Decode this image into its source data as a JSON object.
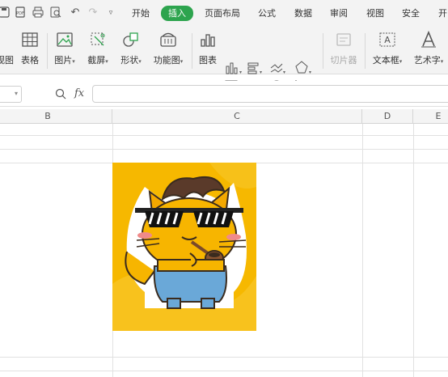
{
  "menubar": {
    "tabs": [
      "开始",
      "插入",
      "页面布局",
      "公式",
      "数据",
      "审阅",
      "视图",
      "安全",
      "开"
    ],
    "active_tab": "插入",
    "active_color": "#2da44e"
  },
  "ribbon": {
    "buttons": {
      "chart_view": "视图",
      "table": "表格",
      "picture": "图片",
      "screenshot": "截屏",
      "shape": "形状",
      "function_chart": "功能图",
      "chart": "图表",
      "slicer": "切片器",
      "textbox": "文本框",
      "wordart": "艺术字"
    }
  },
  "formula_bar": {
    "fx_label": "fx",
    "value": ""
  },
  "columns": {
    "B": "B",
    "C": "C",
    "D": "D",
    "E": "E"
  },
  "image": {
    "description_icon": "cat-with-sunglasses-and-pipe-sticker",
    "background": "#f5b800"
  }
}
